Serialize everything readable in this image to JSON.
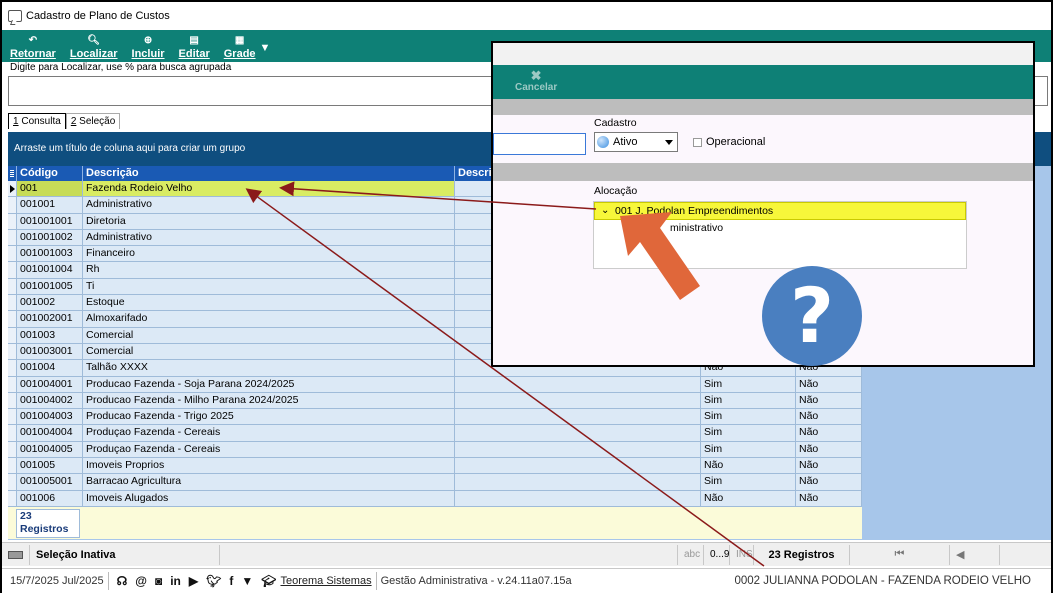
{
  "window": {
    "title": "Cadastro de Plano de Custos"
  },
  "toolbar": {
    "buttons": [
      {
        "label": "Retornar",
        "icon": "back-icon"
      },
      {
        "label": "Localizar",
        "icon": "search-icon"
      },
      {
        "label": "Incluir",
        "icon": "add-icon"
      },
      {
        "label": "Editar",
        "icon": "edit-icon"
      },
      {
        "label": "Grade",
        "icon": "grid-icon"
      }
    ]
  },
  "search": {
    "label": "Digite para Localizar, use % para busca agrupada",
    "value": ""
  },
  "tabs": [
    {
      "num": "1",
      "label": " Consulta",
      "active": true
    },
    {
      "num": "2",
      "label": " Seleção",
      "active": false
    }
  ],
  "groupbar": {
    "text": "Arraste um título de coluna aqui para criar um grupo"
  },
  "grid": {
    "columns": [
      "Código",
      "Descrição",
      "Descrição"
    ],
    "rows": [
      {
        "code": "001",
        "desc": "Fazenda Rodeio Velho",
        "a": "",
        "b": ""
      },
      {
        "code": "001001",
        "desc": "Administrativo",
        "a": "",
        "b": ""
      },
      {
        "code": "001001001",
        "desc": "Diretoria",
        "a": "",
        "b": ""
      },
      {
        "code": "001001002",
        "desc": "Administrativo",
        "a": "",
        "b": ""
      },
      {
        "code": "001001003",
        "desc": "Financeiro",
        "a": "",
        "b": ""
      },
      {
        "code": "001001004",
        "desc": "Rh",
        "a": "",
        "b": ""
      },
      {
        "code": "001001005",
        "desc": "Ti",
        "a": "",
        "b": ""
      },
      {
        "code": "001002",
        "desc": "Estoque",
        "a": "",
        "b": ""
      },
      {
        "code": "001002001",
        "desc": "Almoxarifado",
        "a": "",
        "b": ""
      },
      {
        "code": "001003",
        "desc": "Comercial",
        "a": "",
        "b": ""
      },
      {
        "code": "001003001",
        "desc": "Comercial",
        "a": "",
        "b": ""
      },
      {
        "code": "001004",
        "desc": "Talhão XXXX",
        "a": "Não",
        "b": "Não"
      },
      {
        "code": "001004001",
        "desc": "Producao Fazenda - Soja Parana 2024/2025",
        "a": "Sim",
        "b": "Não"
      },
      {
        "code": "001004002",
        "desc": "Producao Fazenda - Milho Parana 2024/2025",
        "a": "Sim",
        "b": "Não"
      },
      {
        "code": "001004003",
        "desc": "Producao Fazenda - Trigo 2025",
        "a": "Sim",
        "b": "Não"
      },
      {
        "code": "001004004",
        "desc": "Produçao Fazenda - Cereais",
        "a": "Sim",
        "b": "Não"
      },
      {
        "code": "001004005",
        "desc": "Produçao Fazenda - Cereais",
        "a": "Sim",
        "b": "Não"
      },
      {
        "code": "001005",
        "desc": "Imoveis Proprios",
        "a": "Não",
        "b": "Não"
      },
      {
        "code": "001005001",
        "desc": "Barracao Agricultura",
        "a": "Sim",
        "b": "Não"
      },
      {
        "code": "001006",
        "desc": "Imoveis Alugados",
        "a": "Não",
        "b": "Não"
      }
    ],
    "records_count": "23",
    "records_label": "Registros"
  },
  "statusbar": {
    "selection": "Seleção Inativa",
    "abc": "abc",
    "num": "0...9",
    "ins": "INS",
    "records": "23 Registros"
  },
  "footer": {
    "date": "15/7/2025 Jul/2025",
    "company": "Teorema Sistemas",
    "version": "Gestão Administrativa - v.24.11a07.15a",
    "user": "0002 JULIANNA PODOLAN - FAZENDA RODEIO VELHO"
  },
  "overlay": {
    "cancel_label": "Cancelar",
    "cadastro_label": "Cadastro",
    "status_value": "Ativo",
    "operacional_label": "Operacional",
    "alocacao_label": "Alocação",
    "alocacao_item": "001 J. Podolan Empreendimentos",
    "alocacao_sub": "ministrativo"
  },
  "help_badge": "?",
  "colors": {
    "toolbar": "#0e8076",
    "header": "#1a5ab4",
    "row_bg": "#dce9f6",
    "selected_row": "#d9ec63",
    "arrow": "#8b1a1a",
    "pointer": "#e0673a",
    "help_circle": "#4a7fc0"
  }
}
